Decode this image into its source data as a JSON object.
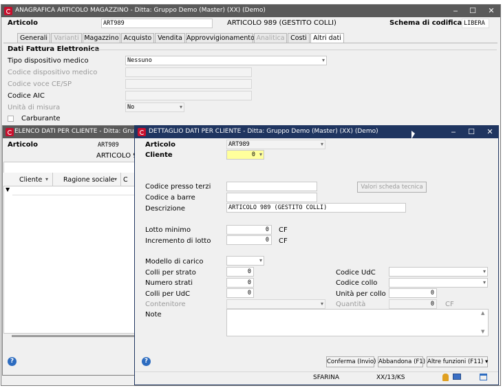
{
  "main_window": {
    "title": "ANAGRAFICA ARTICOLO MAGAZZINO - Ditta: Gruppo Demo (Master) (XX) (Demo)",
    "articolo_label": "Articolo",
    "articolo_code": "ART989",
    "articolo_desc": "ARTICOLO 989 (GESTITO COLLI)",
    "schema_label": "Schema di codifica",
    "schema_value": "LIBERA",
    "tabs": [
      {
        "label": "Generali"
      },
      {
        "label": "Varianti"
      },
      {
        "label": "Magazzino"
      },
      {
        "label": "Acquisto"
      },
      {
        "label": "Vendita"
      },
      {
        "label": "Approvvigionamento"
      },
      {
        "label": "Analitica"
      },
      {
        "label": "Costi"
      },
      {
        "label": "Altri dati"
      }
    ],
    "section_title": "Dati Fattura Elettronica",
    "tipo_dispositivo_label": "Tipo dispositivo medico",
    "tipo_dispositivo_value": "Nessuno",
    "codice_dispositivo_label": "Codice dispositivo medico",
    "codice_voce_label": "Codice voce CE/SP",
    "codice_aic_label": "Codice AIC",
    "unita_misura_label": "Unità di misura",
    "unita_misura_value": "No",
    "carburante_label": "Carburante"
  },
  "list_window": {
    "title": "ELENCO DATI PER CLIENTE - Ditta: Gruppo Demo",
    "articolo_label": "Articolo",
    "articolo_code": "ART989",
    "articolo_desc": "ARTICOLO 9",
    "columns": [
      "Cliente",
      "Ragione sociale",
      "C"
    ]
  },
  "detail_window": {
    "title": "DETTAGLIO DATI PER CLIENTE - Ditta: Gruppo Demo (Master) (XX) (Demo)",
    "articolo_label": "Articolo",
    "articolo_value": "ART989",
    "cliente_label": "Cliente",
    "cliente_value": "0",
    "codice_terzi_label": "Codice presso terzi",
    "valori_button": "Valori scheda tecnica",
    "codice_barre_label": "Codice a barre",
    "descrizione_label": "Descrizione",
    "descrizione_value": "ARTICOLO 989 (GESTITO COLLI)",
    "lotto_minimo_label": "Lotto minimo",
    "lotto_minimo_value": "0",
    "lotto_minimo_unit": "CF",
    "incremento_label": "Incremento di lotto",
    "incremento_value": "0",
    "incremento_unit": "CF",
    "modello_label": "Modello di carico",
    "colli_strato_label": "Colli per strato",
    "colli_strato_value": "0",
    "numero_strati_label": "Numero strati",
    "numero_strati_value": "0",
    "colli_udc_label": "Colli per UdC",
    "colli_udc_value": "0",
    "contenitore_label": "Contenitore",
    "codice_udc_label": "Codice UdC",
    "codice_collo_label": "Codice collo",
    "unita_collo_label": "Unità per collo",
    "unita_collo_value": "0",
    "quantita_label": "Quantità",
    "quantita_value": "0",
    "quantita_unit": "CF",
    "note_label": "Note",
    "conferma_button": "Conferma (Invio)",
    "abbandona_button": "Abbandona (F1)",
    "altre_button": "Altre funzioni (F11)",
    "status_user": "SFARINA",
    "status_info": "XX/13/KS"
  },
  "colors": {
    "active_titlebar": "#1f3560",
    "inactive_titlebar": "#5a5a5a",
    "highlight_field": "#ffff9c"
  }
}
